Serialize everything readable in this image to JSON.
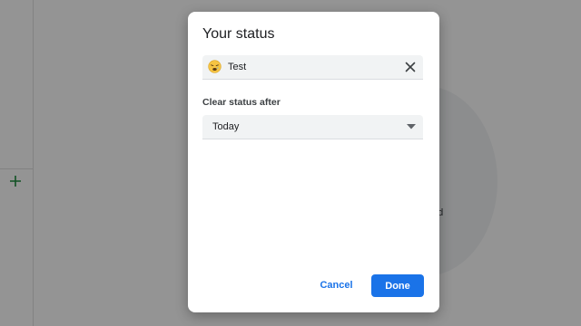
{
  "background": {
    "partial_text": "ed",
    "add_icon": "plus-icon"
  },
  "dialog": {
    "title": "Your status",
    "status": {
      "emoji_icon": "tired-face-emoji-icon",
      "value": "Test",
      "clear_icon": "close-icon"
    },
    "clear_after": {
      "label": "Clear status after",
      "selected": "Today",
      "arrow_icon": "dropdown-arrow-icon"
    },
    "buttons": {
      "cancel_label": "Cancel",
      "done_label": "Done"
    }
  },
  "colors": {
    "accent": "#1a73e8",
    "field_background": "#f1f3f4",
    "overlay": "rgba(0,0,0,0.42)"
  }
}
